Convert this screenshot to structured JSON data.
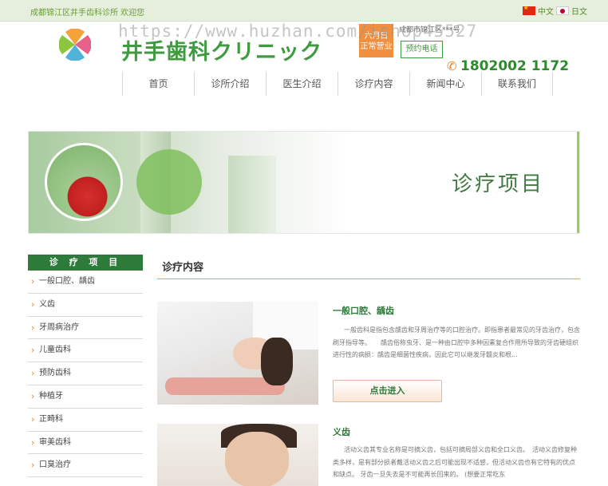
{
  "topbar": {
    "welcome": "成都锦江区井手齿科诊所 欢迎您",
    "lang_cn": "中文",
    "lang_jp": "日文"
  },
  "header": {
    "brand": "井手歯科クリニック",
    "badge": "六月日\n正常营业",
    "address": "成都市锦江区***号",
    "book_label": "预约电话",
    "phone": "1802002 1172",
    "watermark": "https://www.huzhan.com/ishop45527"
  },
  "nav": {
    "items": [
      "首页",
      "诊所介绍",
      "医生介绍",
      "诊疗内容",
      "新闻中心",
      "联系我们"
    ]
  },
  "banner": {
    "title": "诊疗项目"
  },
  "sidebar": {
    "heading": "诊 疗 项 目",
    "items": [
      "一般口腔、龋齿",
      "义齿",
      "牙周病治疗",
      "儿童齿科",
      "预防齿科",
      "种植牙",
      "正畸科",
      "审美齿科",
      "口臭治疗"
    ]
  },
  "content": {
    "heading": "诊疗内容",
    "items": [
      {
        "title": "一般口腔、龋齿",
        "desc": "一般齿科是指包含龋齿和牙周治疗等的口腔治疗。即指患者最常见的牙齿治疗，包含刷牙指导等。　　龋齿俗称虫牙、是一种由口腔中多种因素复合作用所导致的牙齿硬组织进行性的病损：龋齿是细菌性疾病，因此它可以继发牙髓炎和根...",
        "more_label": "点击进入"
      },
      {
        "title": "义齿",
        "desc": "活动义齿其专业名称是可摘义齿，包括可摘局部义齿和全口义齿。　活动义齿修复种类多样，是有部分损者戴活动义齿之后可能出现不适感，但活动义齿也有它特有的优点和缺点。 牙齿一旦失去是不可能再长回来的。 (想要正常吃东"
      }
    ]
  },
  "colors": {
    "brand_green": "#3f9b3f",
    "accent_orange": "#ef8f3f",
    "sidebar_head": "#2d7a3a"
  }
}
